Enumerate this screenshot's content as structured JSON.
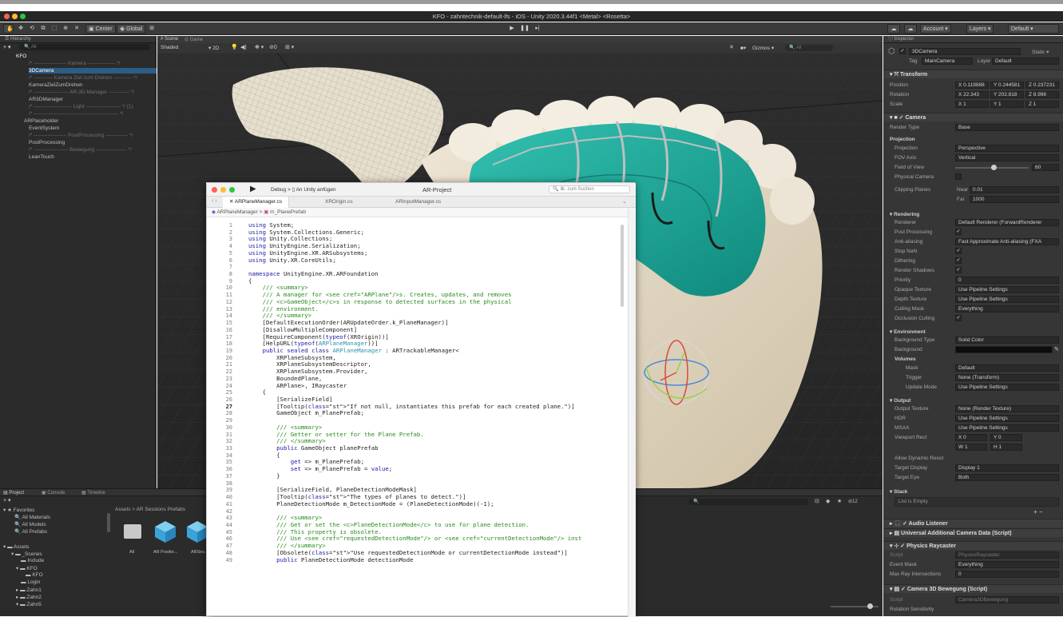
{
  "window": {
    "title": "KFO - zahntechnik-default-lfs - iOS - Unity 2020.3.44f1 <Metal> <Rosetta>"
  },
  "toolbar": {
    "center_label": "Center",
    "global_label": "Global",
    "account_label": "Account",
    "layers_label": "Layers",
    "layout_label": "Default"
  },
  "hierarchy": {
    "tab_label": "Hierarchy",
    "search_placeholder": "All",
    "items": [
      {
        "label": "KFO",
        "dim": false
      },
      {
        "label": "/* ------------------- Kamera ---------------- */",
        "dim": true
      },
      {
        "label": "3DCamera",
        "dim": false
      },
      {
        "label": "/* ----------- Kamera Ziel zum Drehen ----------- */",
        "dim": true
      },
      {
        "label": "KameraZielZumDrehen",
        "dim": false
      },
      {
        "label": "/* -------------------- AR-3D-Manager ------------ */",
        "dim": true
      },
      {
        "label": "AR3DManager",
        "dim": false
      },
      {
        "label": "/* ---------------------- Light -------------------- */ (1)",
        "dim": true
      },
      {
        "label": "/* ------------------------------------------------- */",
        "dim": true
      },
      {
        "label": "ARPlaceholder",
        "dim": false
      },
      {
        "label": "EventSystem",
        "dim": false
      },
      {
        "label": "/* ------------------- PostProcessing ------------- */",
        "dim": true
      },
      {
        "label": "PostProcessing",
        "dim": false
      },
      {
        "label": "/* -------------------- Bewegung ------------------ */",
        "dim": true
      },
      {
        "label": "LeanTouch",
        "dim": false
      }
    ]
  },
  "scene": {
    "tab_scene": "Scene",
    "tab_game": "Game",
    "shading": "Shaded",
    "mode_2d": "2D",
    "gizmos": "Gizmos",
    "search": "All"
  },
  "inspector": {
    "tab_label": "Inspector",
    "object_name": "3DCamera",
    "static_label": "Static",
    "tag_label": "Tag",
    "tag_value": "MainCamera",
    "layer_label": "Layer",
    "layer_value": "Default",
    "transform": {
      "header": "Transform",
      "position_label": "Position",
      "rotation_label": "Rotation",
      "scale_label": "Scale",
      "pos": [
        "X 0.119888",
        "Y 0.244581",
        "Z 0.237231"
      ],
      "rot": [
        "X 22.343",
        "Y 202.818",
        "Z 8.996"
      ],
      "scl": [
        "X 1",
        "Y 1",
        "Z 1"
      ]
    },
    "camera": {
      "header": "Camera",
      "render_type_label": "Render Type",
      "render_type": "Base",
      "projection_header": "Projection",
      "projection_label": "Projection",
      "projection": "Perspective",
      "fov_axis_label": "FOV Axis",
      "fov_axis": "Vertical",
      "fov_label": "Field of View",
      "fov_value": "60",
      "physical_label": "Physical Camera",
      "clipping_label": "Clipping Planes",
      "near_label": "Near",
      "near_value": "0.01",
      "far_label": "Far",
      "far_value": "1000",
      "rendering_header": "Rendering",
      "renderer_label": "Renderer",
      "renderer": "Default Renderer (ForwardRenderer",
      "post_label": "Post Processing",
      "aa_label": "Anti-aliasing",
      "aa_value": "Fast Approximate Anti-aliasing (FXA",
      "stopnan_label": "Stop NaN",
      "dither_label": "Dithering",
      "shadows_label": "Render Shadows",
      "priority_label": "Priority",
      "priority_value": "0",
      "opaque_label": "Opaque Texture",
      "opaque_value": "Use Pipeline Settings",
      "depth_label": "Depth Texture",
      "depth_value": "Use Pipeline Settings",
      "culling_label": "Culling Mask",
      "culling_value": "Everything",
      "occlusion_label": "Occlusion Culling",
      "env_header": "Environment",
      "bgtype_label": "Background Type",
      "bgtype_value": "Solid Color",
      "bg_label": "Background",
      "volumes_label": "Volumes",
      "mask_label": "Mask",
      "mask_value": "Default",
      "trigger_label": "Trigger",
      "trigger_value": "None (Transform)",
      "update_label": "Update Mode",
      "update_value": "Use Pipeline Settings",
      "output_header": "Output",
      "outtex_label": "Output Texture",
      "outtex_value": "None (Render Texture)",
      "hdr_label": "HDR",
      "hdr_value": "Use Pipeline Settings",
      "msaa_label": "MSAA",
      "msaa_value": "Use Pipeline Settings",
      "viewport_label": "Viewport Rect",
      "vx": "X 0",
      "vy": "Y 0",
      "vw": "W 1",
      "vh": "H 1",
      "dynres_label": "Allow Dynamic Resol",
      "tdisplay_label": "Target Display",
      "tdisplay_value": "Display 1",
      "teye_label": "Target Eye",
      "teye_value": "Both",
      "stack_header": "Stack",
      "stack_empty": "List is Empty"
    },
    "components": [
      {
        "label": "Audio Listener"
      },
      {
        "label": "Universal Additional Camera Data (Script)"
      },
      {
        "label": "Physics Raycaster"
      },
      {
        "label": "Camera 3D Bewegung (Script)"
      }
    ],
    "raycaster": {
      "script_label": "Script",
      "script_value": "PhysicsRaycaster",
      "mask_label": "Event Mask",
      "mask_value": "Everything",
      "max_label": "Max Ray Intersections",
      "max_value": "0"
    },
    "bewegung": {
      "script_label": "Script",
      "script_value": "Camera3DBewegung",
      "rotation_label": "Rotation Sensitivity"
    }
  },
  "project": {
    "tab_project": "Project",
    "tab_console": "Console",
    "tab_timeline": "Timeline",
    "favorites_label": "Favorites",
    "favorites": [
      "All Materials",
      "All Models",
      "All Prefabs"
    ],
    "assets_label": "Assets",
    "tree": [
      "_Scenes",
      "Include",
      "KFO",
      "KFO",
      "Login",
      "Zahn1",
      "Zahn2",
      "Zahn5"
    ],
    "breadcrumb": "Assets > AR Sessions Prefabs",
    "assets_items": [
      "All",
      "AR Positio...",
      "ARSes..."
    ],
    "count_label": "12"
  },
  "code": {
    "run_label": "Debug",
    "attach_label": "An Unity anfügen",
    "project_title": "AR-Project",
    "search_placeholder": "⌘. zum Suchen",
    "tabs": [
      "ARPlaneManager.cs",
      "XROrigin.cs",
      "ARInputManager.cs"
    ],
    "breadcrumb_class": "ARPlaneManager",
    "breadcrumb_member": "m_PlanePrefab",
    "lines": [
      "using System;",
      "using System.Collections.Generic;",
      "using Unity.Collections;",
      "using UnityEngine.Serialization;",
      "using UnityEngine.XR.ARSubsystems;",
      "using Unity.XR.CoreUtils;",
      "",
      "namespace UnityEngine.XR.ARFoundation",
      "{",
      "    /// <summary>",
      "    /// A manager for <see cref=\"ARPlane\"/>s. Creates, updates, and removes",
      "    /// <c>GameObject</c>s in response to detected surfaces in the physical",
      "    /// environment.",
      "    /// </summary>",
      "    [DefaultExecutionOrder(ARUpdateOrder.k_PlaneManager)]",
      "    [DisallowMultipleComponent]",
      "    [RequireComponent(typeof(XROrigin))]",
      "    [HelpURL(typeof(ARPlaneManager))]",
      "    public sealed class ARPlaneManager : ARTrackableManager<",
      "        XRPlaneSubsystem,",
      "        XRPlaneSubsystemDescriptor,",
      "        XRPlaneSubsystem.Provider,",
      "        BoundedPlane,",
      "        ARPlane>, IRaycaster",
      "    {",
      "        [SerializeField]",
      "        [Tooltip(\"If not null, instantiates this prefab for each created plane.\")]",
      "        GameObject m_PlanePrefab;",
      "",
      "        /// <summary>",
      "        /// Getter or setter for the Plane Prefab.",
      "        /// </summary>",
      "        public GameObject planePrefab",
      "        {",
      "            get => m_PlanePrefab;",
      "            set => m_PlanePrefab = value;",
      "        }",
      "",
      "        [SerializeField, PlaneDetectionModeMask]",
      "        [Tooltip(\"The types of planes to detect.\")]",
      "        PlaneDetectionMode m_DetectionMode = (PlaneDetectionMode)(-1);",
      "",
      "        /// <summary>",
      "        /// Get or set the <c>PlaneDetectionMode</c> to use for plane detection.",
      "        /// This property is obsolete.",
      "        /// Use <see cref=\"requestedDetectionMode\"/> or <see cref=\"currentDetectionMode\"/> inst",
      "        /// </summary>",
      "        [Obsolete(\"Use requestedDetectionMode or currentDetectionMode instead\")]",
      "        public PlaneDetectionMode detectionMode"
    ]
  },
  "colors": {
    "accent": "#2e6fd8",
    "teal": "#1fa89a",
    "comment": "#288a1c"
  }
}
